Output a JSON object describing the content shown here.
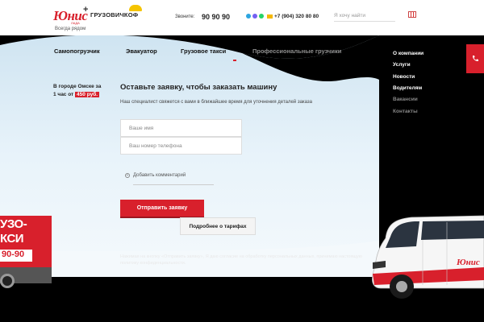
{
  "header": {
    "logo_text": "Юнис",
    "logo_sub": "ЛАДА",
    "plus": "+",
    "partner_name": "ГРУЗОВИЧКОФ",
    "tagline": "Всегда рядом",
    "call_label": "Звоните:",
    "call_number": "90 90 90",
    "mobile_number": "+7 (904) 320 80 80",
    "search_placeholder": "Я хочу найти"
  },
  "nav": {
    "items": [
      {
        "label": "Самопогрузчик"
      },
      {
        "label": "Эвакуатор"
      },
      {
        "label": "Грузовое такси"
      },
      {
        "label": "Профессиональные грузчики"
      }
    ]
  },
  "right_menu": {
    "items": [
      {
        "label": "О компании"
      },
      {
        "label": "Услуги"
      },
      {
        "label": "Новости"
      },
      {
        "label": "Водителям"
      },
      {
        "label": "Вакансии"
      },
      {
        "label": "Контакты"
      }
    ]
  },
  "promo": {
    "line1": "В городе Омске за",
    "line2_prefix": "1 час от",
    "price": "450 руб."
  },
  "form": {
    "title": "Оставьте заявку, чтобы заказать машину",
    "subtitle": "Наш специалист свяжется с вами в ближайшее время для уточнения деталей заказа",
    "name_placeholder": "Ваше имя",
    "phone_placeholder": "Ваш номер телефона",
    "add_comment": "Добавить комментарий",
    "submit": "Отправить заявку",
    "tariffs": "Подробнее о тарифах",
    "consent": "Нажимая на кнопку «Отправить заявку», Я даю согласие на обработку персональных данных, принимаю настоящую политику конфиденциальности."
  },
  "truck_left": {
    "line1": "УЗО-",
    "line2": "КСИ",
    "line3": "90-90"
  },
  "van_right": {
    "brand": "Юнис"
  },
  "colors": {
    "brand_red": "#d8202c",
    "sky": "#e3f0f8",
    "dark": "#000000"
  }
}
